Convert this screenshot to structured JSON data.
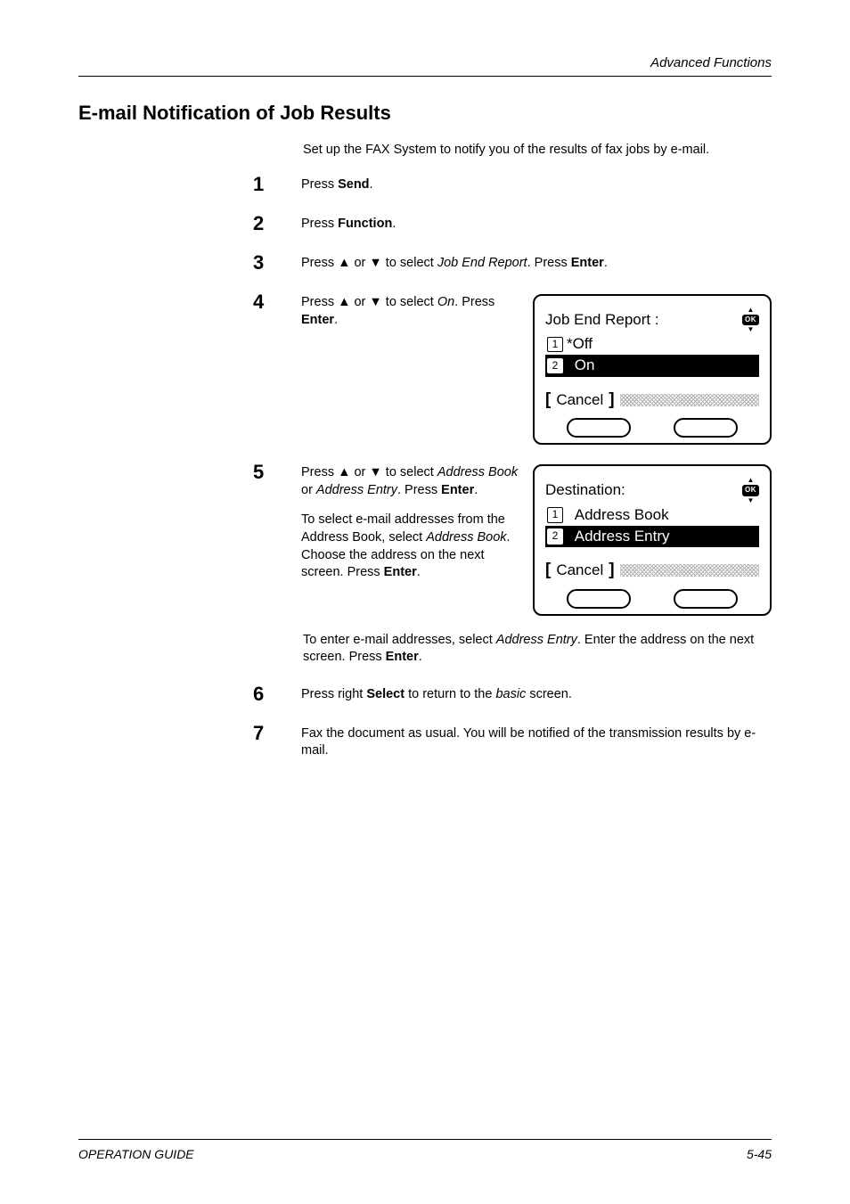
{
  "header": {
    "section": "Advanced Functions"
  },
  "title": "E-mail Notification of Job Results",
  "intro": "Set up the FAX System to notify you of the results of fax jobs by e-mail.",
  "steps": {
    "s1": {
      "num": "1",
      "pre": "Press ",
      "bold": "Send",
      "post": "."
    },
    "s2": {
      "num": "2",
      "pre": "Press ",
      "bold": "Function",
      "post": "."
    },
    "s3": {
      "num": "3",
      "pre1": "Press ",
      "tri1": "▲",
      "mid1": " or ",
      "tri2": "▼",
      "mid2": " to select ",
      "ital": "Job End Report",
      "mid3": ". Press ",
      "bold": "Enter",
      "post": "."
    },
    "s4": {
      "num": "4",
      "pre1": "Press ",
      "tri1": "▲",
      "mid1": " or ",
      "tri2": "▼",
      "mid2": " to select ",
      "ital": "On",
      "mid3": ". Press ",
      "bold": "Enter",
      "post": "."
    },
    "s5": {
      "num": "5",
      "pre1": "Press ",
      "tri1": "▲",
      "mid1": " or ",
      "tri2": "▼",
      "mid2": " to select ",
      "ital1": "Address Book",
      "or": " or ",
      "ital2": "Address Entry",
      "mid3": ". Press ",
      "bold1": "Enter",
      "post1": ".",
      "para2a": "To select e-mail addresses from the Address Book, select ",
      "para2ital": "Address Book",
      "para2b": ". Choose the address on the next screen. Press ",
      "para2bold": "Enter",
      "para2post": "."
    },
    "after5": {
      "pre": "To enter e-mail addresses, select ",
      "ital": "Address Entry",
      "mid": ". Enter the address on the next screen. Press ",
      "bold": "Enter",
      "post": "."
    },
    "s6": {
      "num": "6",
      "pre": "Press right ",
      "bold": "Select",
      "mid": " to return to the ",
      "ital": "basic",
      "post": " screen."
    },
    "s7": {
      "num": "7",
      "text": "Fax the document as usual. You will be notified of the transmission results by e-mail."
    }
  },
  "lcd1": {
    "title": "Job End Report :",
    "ok": "OK",
    "opt1_num": "1",
    "opt1_label": "*Off",
    "opt2_num": "2",
    "opt2_label": "On",
    "cancel": "Cancel"
  },
  "lcd2": {
    "title": "Destination:",
    "ok": "OK",
    "opt1_num": "1",
    "opt1_label": "Address Book",
    "opt2_num": "2",
    "opt2_label": "Address Entry",
    "cancel": "Cancel"
  },
  "footer": {
    "guide": "OPERATION GUIDE",
    "page": "5-45"
  }
}
